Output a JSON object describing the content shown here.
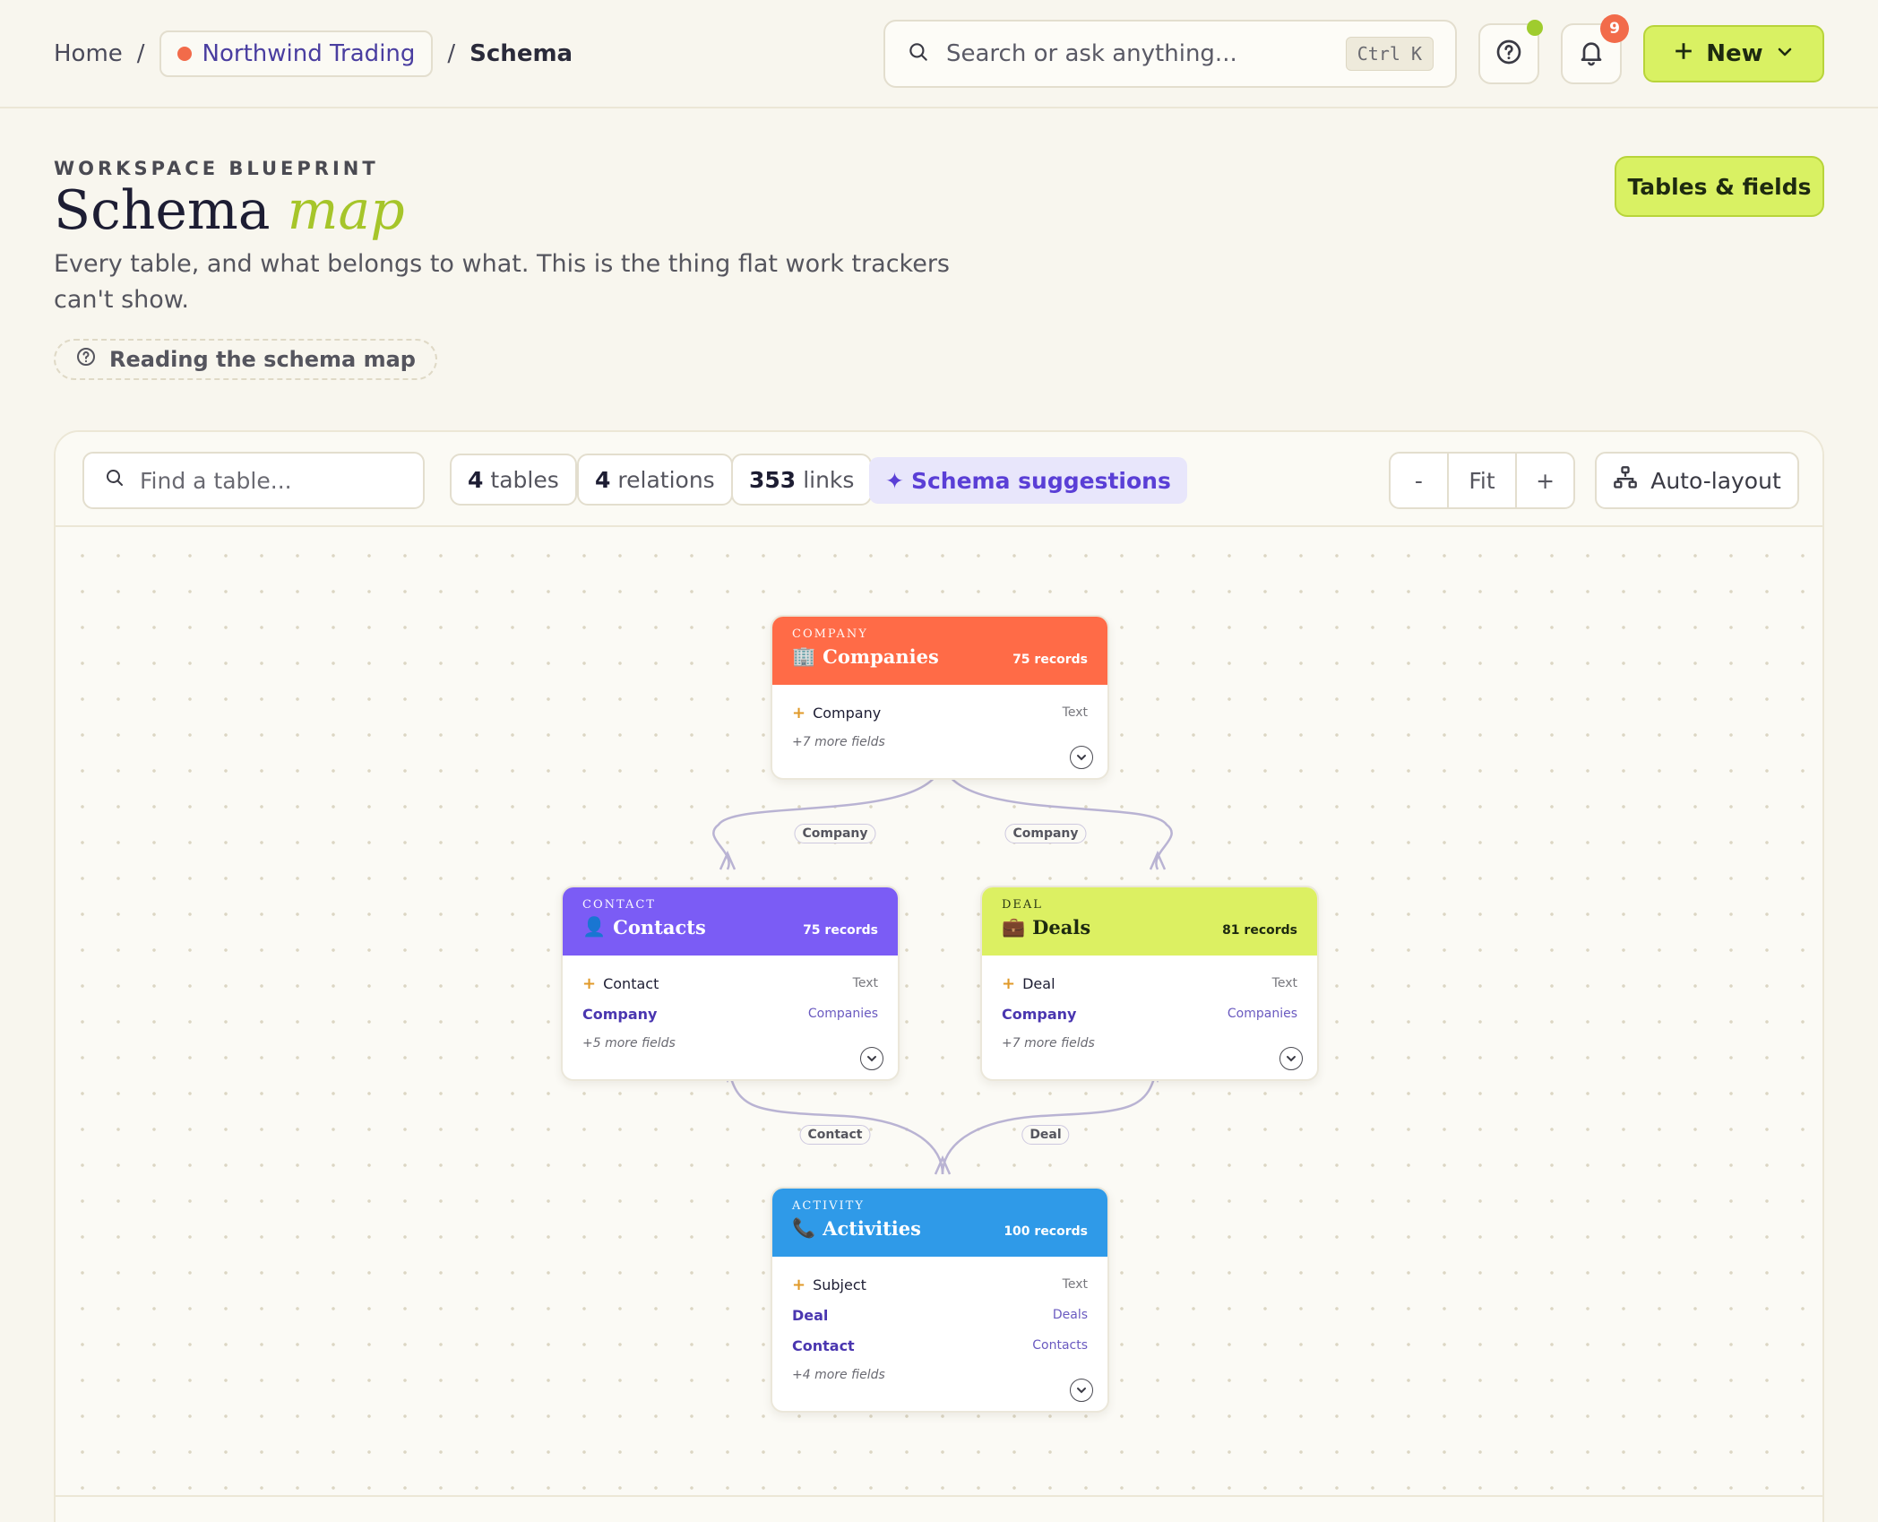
{
  "breadcrumb": {
    "home": "Home",
    "workspace": "Northwind Trading",
    "current": "Schema"
  },
  "search": {
    "placeholder": "Search or ask anything...",
    "shortcut": "Ctrl K"
  },
  "notifications": {
    "count": "9"
  },
  "new_button": {
    "label": "New"
  },
  "header": {
    "eyebrow": "WORKSPACE BLUEPRINT",
    "title_main": "Schema",
    "title_accent": "map",
    "description": "Every table, and what belongs to what. This is the thing flat work trackers can't show.",
    "reading_link": "Reading the schema map",
    "tables_button": "Tables & fields"
  },
  "toolbar": {
    "find_placeholder": "Find a table...",
    "tables_count": "4",
    "tables_label": "tables",
    "relations_count": "4",
    "relations_label": "relations",
    "links_count": "353",
    "links_label": "links",
    "suggestions": "Schema suggestions",
    "zoom_out": "-",
    "zoom_fit": "Fit",
    "zoom_in": "+",
    "auto_layout": "Auto-layout"
  },
  "nodes": {
    "companies": {
      "kind": "COMPANY",
      "icon": "building-icon",
      "title": "Companies",
      "count": "75 records",
      "color": "#ff6b47",
      "fields": [
        {
          "name": "Company",
          "type": "Text"
        }
      ],
      "more": "+7 more fields"
    },
    "contacts": {
      "kind": "CONTACT",
      "icon": "person-icon",
      "title": "Contacts",
      "count": "75 records",
      "color": "#7b5cf5",
      "fields": [
        {
          "name": "Contact",
          "type": "Text"
        },
        {
          "name": "Company",
          "type": "Companies"
        }
      ],
      "more": "+5 more fields"
    },
    "deals": {
      "kind": "DEAL",
      "icon": "briefcase-icon",
      "title": "Deals",
      "count": "81 records",
      "color": "#dcf062",
      "fields": [
        {
          "name": "Deal",
          "type": "Text"
        },
        {
          "name": "Company",
          "type": "Companies"
        }
      ],
      "more": "+7 more fields"
    },
    "activities": {
      "kind": "ACTIVITY",
      "icon": "phone-icon",
      "title": "Activities",
      "count": "100 records",
      "color": "#2f9ae8",
      "fields": [
        {
          "name": "Subject",
          "type": "Text"
        },
        {
          "name": "Deal",
          "type": "Deals"
        },
        {
          "name": "Contact",
          "type": "Contacts"
        }
      ],
      "more": "+4 more fields"
    }
  },
  "edges": [
    {
      "from": "contacts",
      "to": "companies",
      "label": "Company"
    },
    {
      "from": "deals",
      "to": "companies",
      "label": "Company"
    },
    {
      "from": "activities",
      "to": "contacts",
      "label": "Contact"
    },
    {
      "from": "activities",
      "to": "deals",
      "label": "Deal"
    }
  ]
}
